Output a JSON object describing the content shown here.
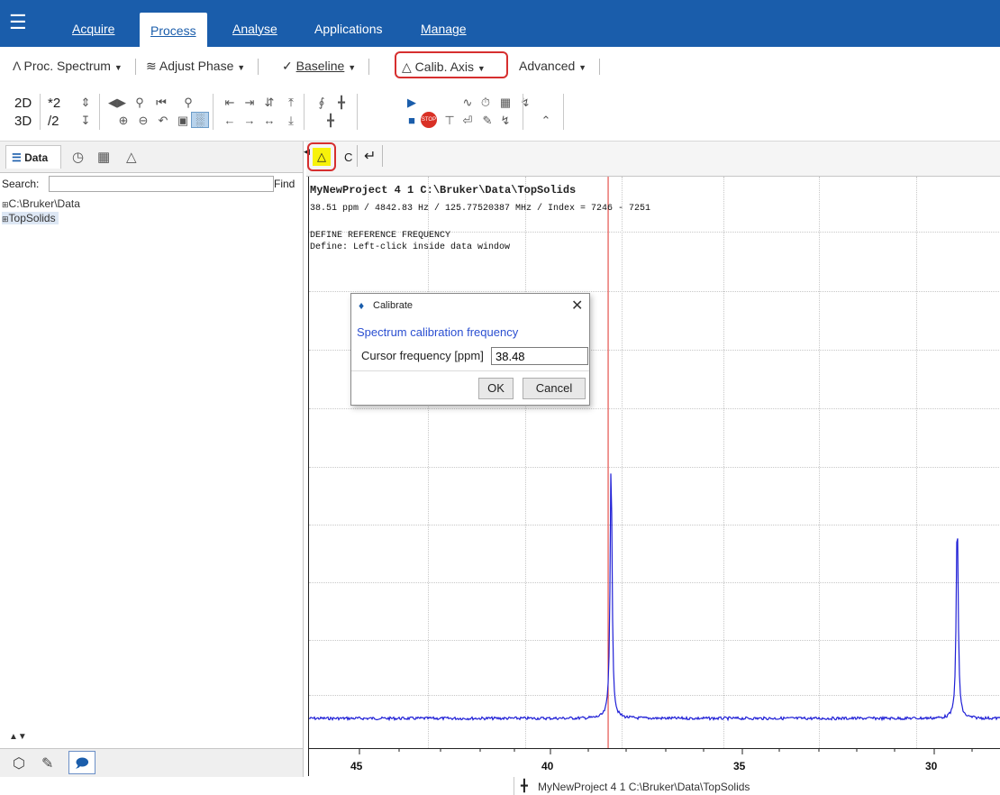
{
  "menubar": {
    "items": [
      "Acquire",
      "Process",
      "Analyse",
      "Applications",
      "Manage"
    ],
    "active": "Process"
  },
  "toolbar1": {
    "proc_spectrum": "Proc. Spectrum",
    "adjust_phase": "Adjust Phase",
    "baseline": "Baseline",
    "calib_axis": "Calib. Axis",
    "advanced": "Advanced"
  },
  "toolbar2": {
    "dim_2d": "2D",
    "dim_3d": "3D",
    "mul2": "*2",
    "div2": "/2"
  },
  "leftpanel": {
    "data_tab": "Data",
    "search_label": "Search:",
    "find_label": "Find",
    "tree": [
      "C:\\Bruker\\Data",
      "TopSolids"
    ]
  },
  "datatabs": {
    "c_label": "C"
  },
  "spectrum": {
    "title": "MyNewProject 4 1 C:\\Bruker\\Data\\TopSolids",
    "cursor_info": "38.51 ppm / 4842.83 Hz / 125.77520387 MHz / Index = 7246 - 7251",
    "define_line1": "DEFINE REFERENCE FREQUENCY",
    "define_line2": "Define: Left-click inside data window",
    "axis_ticks": [
      "45",
      "40",
      "35",
      "30"
    ],
    "cursor_ppm": 38.51,
    "peaks_ppm": [
      38.48,
      29.4
    ],
    "trace_color": "#1f1fd6",
    "cursor_color": "#e0302a"
  },
  "dialog": {
    "title": "Calibrate",
    "heading": "Spectrum calibration frequency",
    "field_label": "Cursor frequency [ppm]",
    "field_value": "38.48",
    "ok": "OK",
    "cancel": "Cancel"
  },
  "statusbar": {
    "text": "MyNewProject 4 1 C:\\Bruker\\Data\\TopSolids"
  },
  "colors": {
    "menubar": "#1a5dab",
    "highlight": "#d62f2f",
    "active_tool": "#f7f20a"
  }
}
